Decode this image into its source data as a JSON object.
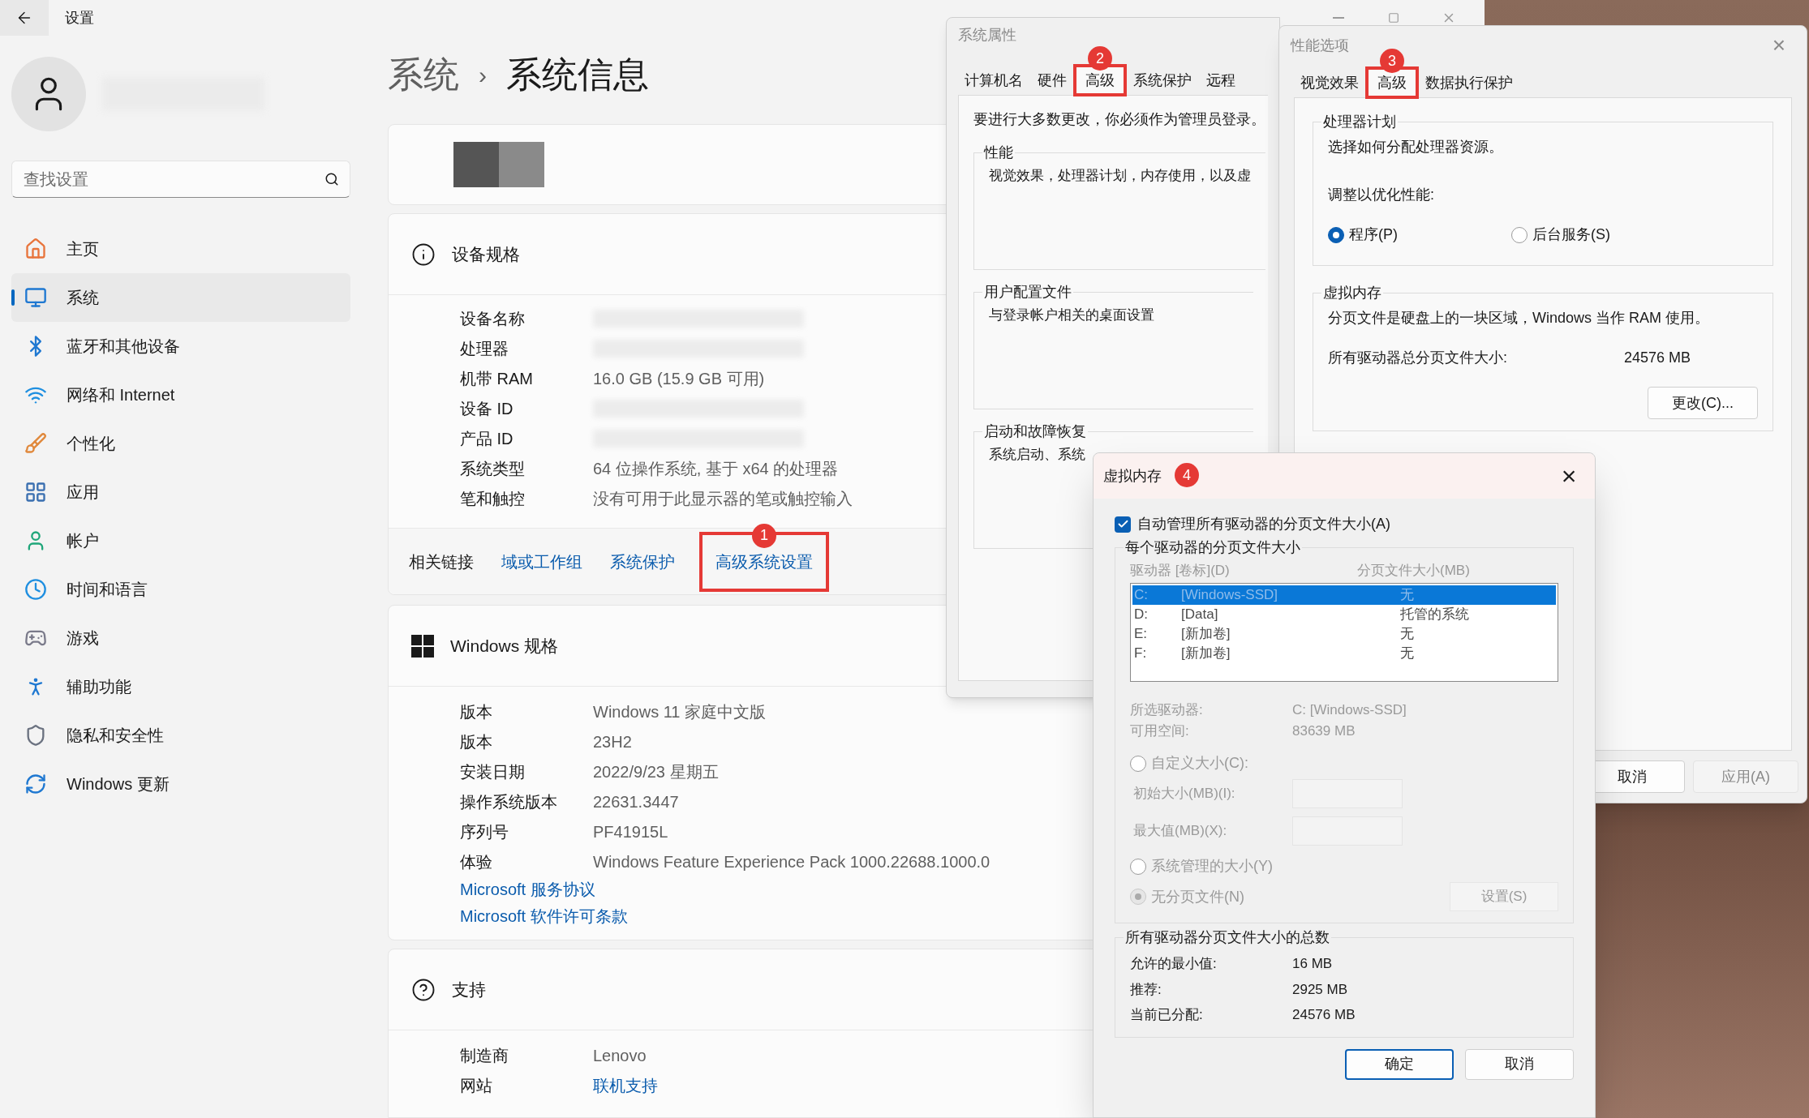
{
  "settings": {
    "title": "设置",
    "breadcrumb": {
      "parent": "系统",
      "separator": "›",
      "current": "系统信息"
    },
    "search": {
      "placeholder": "查找设置"
    },
    "nav": [
      {
        "label": "主页",
        "selected": false
      },
      {
        "label": "系统",
        "selected": true
      },
      {
        "label": "蓝牙和其他设备",
        "selected": false
      },
      {
        "label": "网络和 Internet",
        "selected": false
      },
      {
        "label": "个性化",
        "selected": false
      },
      {
        "label": "应用",
        "selected": false
      },
      {
        "label": "帐户",
        "selected": false
      },
      {
        "label": "时间和语言",
        "selected": false
      },
      {
        "label": "游戏",
        "selected": false
      },
      {
        "label": "辅助功能",
        "selected": false
      },
      {
        "label": "隐私和安全性",
        "selected": false
      },
      {
        "label": "Windows 更新",
        "selected": false
      }
    ]
  },
  "device_specs": {
    "title": "设备规格",
    "rows": [
      {
        "label": "设备名称",
        "redacted": true
      },
      {
        "label": "处理器",
        "redacted": true
      },
      {
        "label": "机带 RAM",
        "value": "16.0 GB (15.9 GB 可用)",
        "redacted": false
      },
      {
        "label": "设备 ID",
        "redacted": true
      },
      {
        "label": "产品 ID",
        "redacted": true
      },
      {
        "label": "系统类型",
        "value": "64 位操作系统, 基于 x64 的处理器",
        "redacted": false
      },
      {
        "label": "笔和触控",
        "value": "没有可用于此显示器的笔或触控输入",
        "redacted": false
      }
    ],
    "related": {
      "label": "相关链接",
      "links": [
        {
          "text": "域或工作组",
          "highlighted": false
        },
        {
          "text": "系统保护",
          "highlighted": false
        },
        {
          "text": "高级系统设置",
          "highlighted": true,
          "badge": "1"
        }
      ]
    }
  },
  "windows_specs": {
    "title": "Windows 规格",
    "rows": [
      {
        "label": "版本",
        "value": "Windows 11 家庭中文版"
      },
      {
        "label": "版本",
        "value": "23H2"
      },
      {
        "label": "安装日期",
        "value": "2022/9/23 星期五"
      },
      {
        "label": "操作系统版本",
        "value": "22631.3447"
      },
      {
        "label": "序列号",
        "value": "PF41915L"
      },
      {
        "label": "体验",
        "value": "Windows Feature Experience Pack 1000.22688.1000.0"
      }
    ],
    "links": [
      "Microsoft 服务协议",
      "Microsoft 软件许可条款"
    ]
  },
  "support": {
    "title": "支持",
    "rows": [
      {
        "label": "制造商",
        "value": "Lenovo",
        "kind": "text"
      },
      {
        "label": "网站",
        "value": "联机支持",
        "kind": "link"
      }
    ]
  },
  "system_properties": {
    "title": "系统属性",
    "tabs": [
      {
        "label": "计算机名",
        "selected": false,
        "highlighted": false
      },
      {
        "label": "硬件",
        "selected": false,
        "highlighted": false
      },
      {
        "label": "高级",
        "selected": true,
        "highlighted": true,
        "badge": "2"
      },
      {
        "label": "系统保护",
        "selected": false,
        "highlighted": false
      },
      {
        "label": "远程",
        "selected": false,
        "highlighted": false
      }
    ],
    "notice": "要进行大多数更改，你必须作为管理员登录。",
    "groups": [
      {
        "title": "性能",
        "text": "视觉效果，处理器计划，内存使用，以及虚"
      },
      {
        "title": "用户配置文件",
        "text": "与登录帐户相关的桌面设置"
      },
      {
        "title": "启动和故障恢复",
        "text": "系统启动、系统"
      }
    ]
  },
  "performance_options": {
    "title": "性能选项",
    "close": "×",
    "tabs": [
      {
        "label": "视觉效果",
        "selected": false,
        "highlighted": false
      },
      {
        "label": "高级",
        "selected": true,
        "highlighted": true,
        "badge": "3"
      },
      {
        "label": "数据执行保护",
        "selected": false,
        "highlighted": false
      }
    ],
    "processor": {
      "title": "处理器计划",
      "text": "选择如何分配处理器资源。",
      "adjust": "调整以优化性能:",
      "options": [
        {
          "label": "程序(P)",
          "selected": true
        },
        {
          "label": "后台服务(S)",
          "selected": false
        }
      ]
    },
    "virtual_memory": {
      "title": "虚拟内存",
      "text": "分页文件是硬盘上的一块区域，Windows 当作 RAM 使用。",
      "total_label": "所有驱动器总分页文件大小:",
      "total_value": "24576 MB",
      "button": "更改(C)..."
    },
    "buttons": [
      {
        "label": "取消",
        "disabled": false
      },
      {
        "label": "应用(A)",
        "disabled": true
      }
    ]
  },
  "virtual_memory": {
    "title": "虚拟内存",
    "badge": "4",
    "close": "×",
    "auto": {
      "label": "自动管理所有驱动器的分页文件大小(A)",
      "checked": true
    },
    "per_drive": {
      "title": "每个驱动器的分页文件大小",
      "columns": [
        "驱动器 [卷标](D)",
        "分页文件大小(MB)"
      ],
      "drives": [
        {
          "drive": "C:",
          "volume": "[Windows-SSD]",
          "size": "无",
          "selected": true
        },
        {
          "drive": "D:",
          "volume": "[Data]",
          "size": "托管的系统",
          "selected": false
        },
        {
          "drive": "E:",
          "volume": "[新加卷]",
          "size": "无",
          "selected": false
        },
        {
          "drive": "F:",
          "volume": "[新加卷]",
          "size": "无",
          "selected": false
        }
      ],
      "selected_label": "所选驱动器:",
      "selected_value": "C:  [Windows-SSD]",
      "free_label": "可用空间:",
      "free_value": "83639 MB",
      "custom": {
        "label": "自定义大小(C):",
        "selected": false
      },
      "initial_label": "初始大小(MB)(I):",
      "max_label": "最大值(MB)(X):",
      "system_managed": {
        "label": "系统管理的大小(Y)",
        "selected": false
      },
      "no_paging": {
        "label": "无分页文件(N)",
        "selected": true
      },
      "set_button": "设置(S)"
    },
    "totals": {
      "title": "所有驱动器分页文件大小的总数",
      "rows": [
        {
          "label": "允许的最小值:",
          "value": "16 MB"
        },
        {
          "label": "推荐:",
          "value": "2925 MB"
        },
        {
          "label": "当前已分配:",
          "value": "24576 MB"
        }
      ]
    },
    "buttons": [
      {
        "label": "确定",
        "primary": true
      },
      {
        "label": "取消",
        "primary": false
      }
    ]
  }
}
